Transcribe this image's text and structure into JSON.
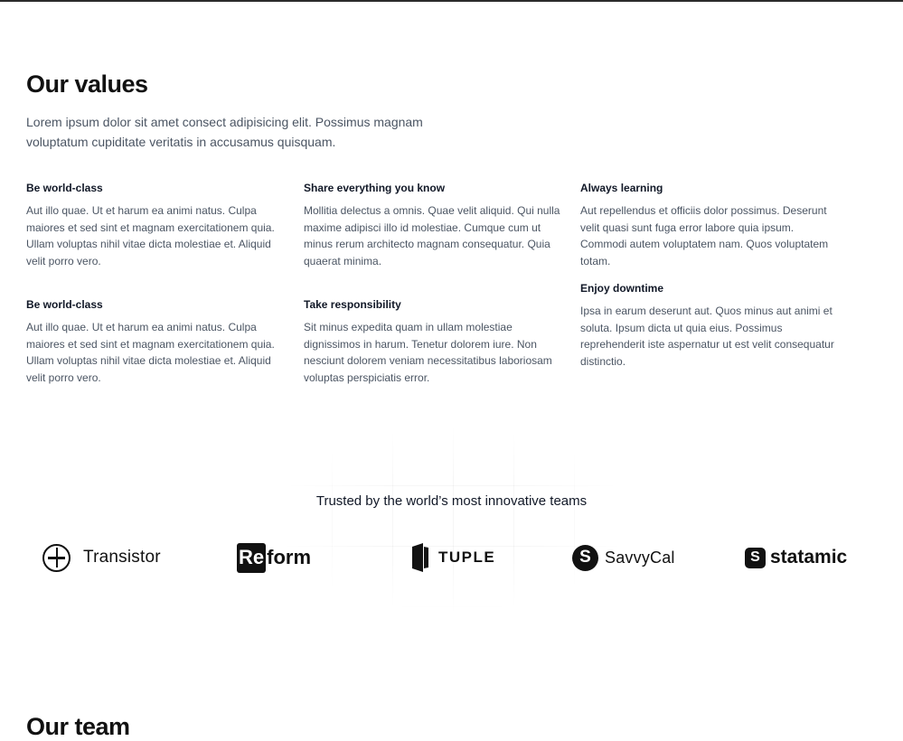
{
  "values": {
    "title": "Our values",
    "intro": "Lorem ipsum dolor sit amet consect adipisicing elit. Possimus magnam voluptatum cupiditate veritatis in accusamus quisquam.",
    "items": [
      {
        "title": "Be world-class",
        "body": "Aut illo quae. Ut et harum ea animi natus. Culpa maiores et sed sint et magnam exercitationem quia. Ullam voluptas nihil vitae dicta molestiae et. Aliquid velit porro vero."
      },
      {
        "title": "Share everything you know",
        "body": "Mollitia delectus a omnis. Quae velit aliquid. Qui nulla maxime adipisci illo id molestiae. Cumque cum ut minus rerum architecto magnam consequatur. Quia quaerat minima."
      },
      {
        "title": "Always learning",
        "body": "Aut repellendus et officiis dolor possimus. Deserunt velit quasi sunt fuga error labore quia ipsum. Commodi autem voluptatem nam. Quos voluptatem totam."
      },
      {
        "title": "Be world-class",
        "body": "Aut illo quae. Ut et harum ea animi natus. Culpa maiores et sed sint et magnam exercitationem quia. Ullam voluptas nihil vitae dicta molestiae et. Aliquid velit porro vero."
      },
      {
        "title": "Take responsibility",
        "body": "Sit minus expedita quam in ullam molestiae dignissimos in harum. Tenetur dolorem iure. Non nesciunt dolorem veniam necessitatibus laboriosam voluptas perspiciatis error."
      },
      {
        "title": "Enjoy downtime",
        "body": "Ipsa in earum deserunt aut. Quos minus aut animi et soluta. Ipsum dicta ut quia eius. Possimus reprehenderit iste aspernatur ut est velit consequatur distinctio."
      }
    ]
  },
  "trusted": {
    "heading": "Trusted by the world’s most innovative teams",
    "logos": {
      "transistor": "Transistor",
      "reform_re": "Re",
      "reform_rest": "form",
      "tuple": "TUPLE",
      "savvycal_badge": "S",
      "savvycal": "SavvyCal",
      "statamic_badge": "S",
      "statamic": "statamic"
    }
  },
  "team": {
    "title": "Our team"
  },
  "colors": {
    "text_dark": "#111827",
    "text_muted": "#4b5563",
    "background": "#ffffff"
  }
}
